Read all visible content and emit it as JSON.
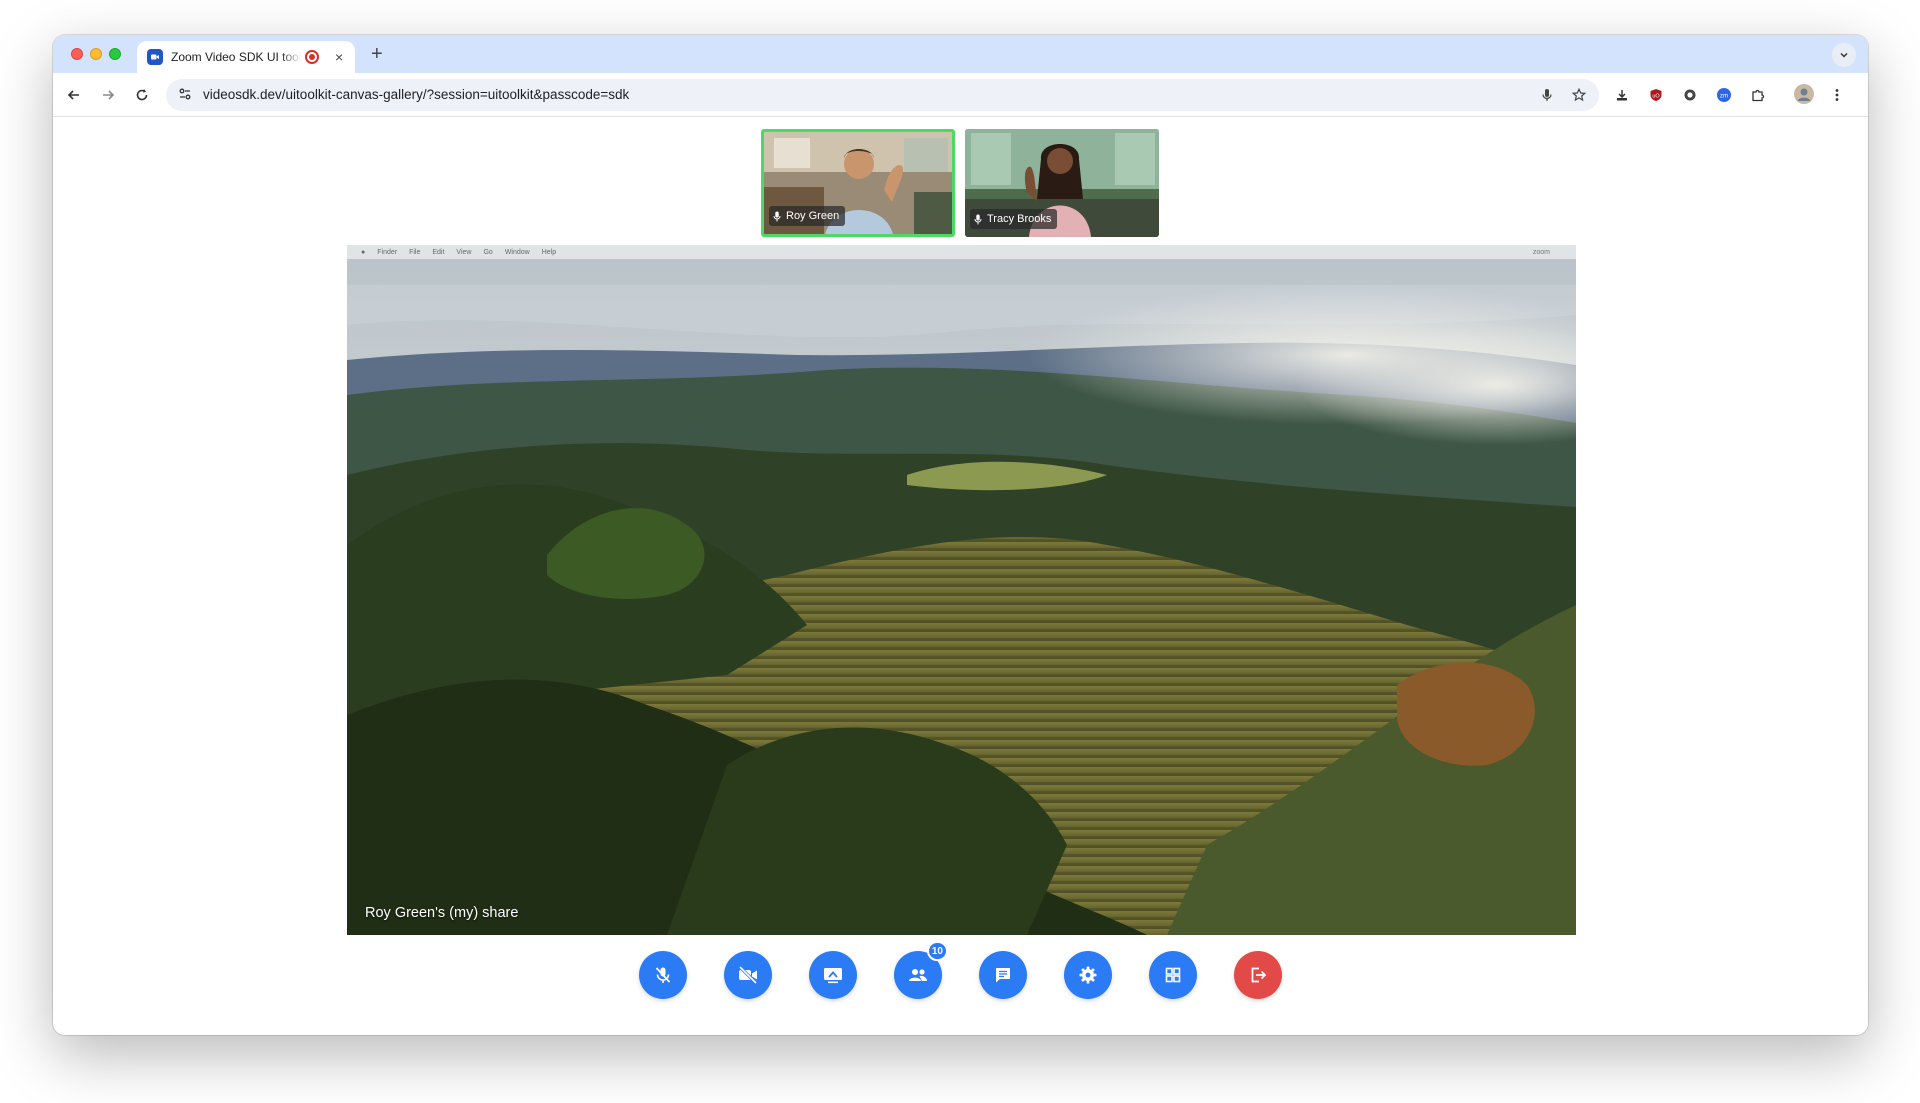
{
  "browser": {
    "tab": {
      "title": "Zoom Video SDK UI toolkit",
      "favicon": "zoom-icon",
      "recording_indicator": "record-icon",
      "close": "×"
    },
    "new_tab": "+",
    "url": "videosdk.dev/uitoolkit-canvas-gallery/?session=uitoolkit&passcode=sdk",
    "extensions": [
      "download-icon",
      "ublock-icon",
      "circle-icon",
      "zoom-extension-icon",
      "puzzle-icon"
    ]
  },
  "gallery": {
    "participants": [
      {
        "name": "Roy Green",
        "active": true,
        "mic": "microphone-icon"
      },
      {
        "name": "Tracy Brooks",
        "active": false,
        "mic": "microphone-icon"
      }
    ]
  },
  "share": {
    "caption": "Roy Green's (my) share",
    "menubar": {
      "items": [
        "Finder",
        "File",
        "Edit",
        "View",
        "Go",
        "Window",
        "Help"
      ],
      "right": "zoom"
    }
  },
  "controls": {
    "buttons": [
      {
        "name": "mute-button",
        "icon": "mic-off-icon"
      },
      {
        "name": "stop-video-button",
        "icon": "video-off-icon"
      },
      {
        "name": "share-screen-button",
        "icon": "screen-share-icon"
      },
      {
        "name": "participants-button",
        "icon": "people-icon",
        "badge": "10"
      },
      {
        "name": "chat-button",
        "icon": "chat-icon"
      },
      {
        "name": "settings-button",
        "icon": "gear-icon"
      },
      {
        "name": "gallery-view-button",
        "icon": "grid-icon"
      },
      {
        "name": "leave-button",
        "icon": "leave-icon"
      }
    ]
  },
  "colors": {
    "accent": "#2a7bf4",
    "leave": "#e24a48",
    "active_border": "#4cd964",
    "tab_strip": "#d3e3fd"
  }
}
